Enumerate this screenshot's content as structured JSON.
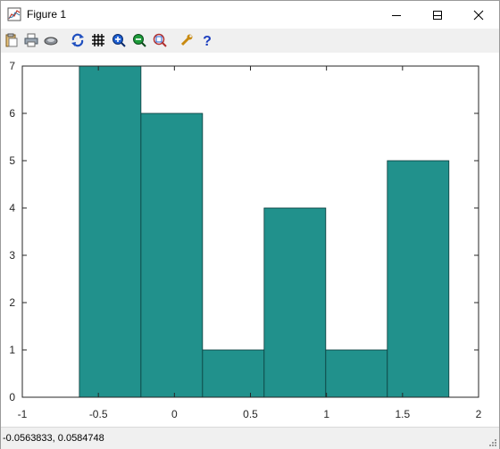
{
  "window": {
    "title": "Figure 1"
  },
  "toolbar": {
    "items": [
      "copy-icon",
      "print-icon",
      "preview-icon",
      "rotate-icon",
      "grid-icon",
      "zoom-in-icon",
      "zoom-out-icon",
      "autoscale-icon",
      "settings-icon",
      "help-icon"
    ]
  },
  "colors": {
    "bar_fill": "#21918c",
    "bar_edge": "#0b3b3a",
    "toolbar_bg": "#f0f0f0"
  },
  "chart_data": {
    "type": "bar",
    "title": "",
    "xlabel": "",
    "ylabel": "",
    "bin_edges": [
      -0.625,
      -0.22,
      0.185,
      0.59,
      0.995,
      1.4,
      1.805
    ],
    "values": [
      7,
      6,
      1,
      4,
      1,
      5
    ],
    "xlim": [
      -1,
      2
    ],
    "ylim": [
      0,
      7
    ],
    "xticks": [
      -1,
      -0.5,
      0,
      0.5,
      1,
      1.5,
      2
    ],
    "xtick_labels": [
      "-1",
      "-0.5",
      "0",
      "0.5",
      "1",
      "1.5",
      "2"
    ],
    "yticks": [
      0,
      1,
      2,
      3,
      4,
      5,
      6,
      7
    ],
    "ytick_labels": [
      "0",
      "1",
      "2",
      "3",
      "4",
      "5",
      "6",
      "7"
    ],
    "grid": false,
    "legend": "none"
  },
  "status": {
    "coordinates": "-0.0563833,  0.0584748"
  }
}
